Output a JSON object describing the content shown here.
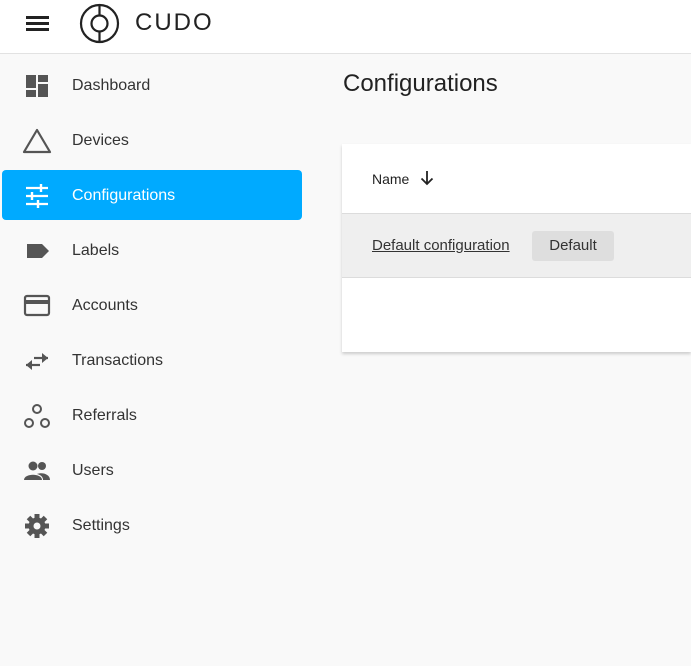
{
  "header": {
    "brand": "CUDO",
    "menu_icon": "hamburger-icon",
    "logo_icon": "cudo-logo-icon"
  },
  "sidebar": {
    "items": [
      {
        "label": "Dashboard",
        "icon": "dashboard-icon",
        "active": false
      },
      {
        "label": "Devices",
        "icon": "triangle-icon",
        "active": false
      },
      {
        "label": "Configurations",
        "icon": "tune-sliders-icon",
        "active": true
      },
      {
        "label": "Labels",
        "icon": "label-tag-icon",
        "active": false
      },
      {
        "label": "Accounts",
        "icon": "credit-card-icon",
        "active": false
      },
      {
        "label": "Transactions",
        "icon": "swap-arrows-icon",
        "active": false
      },
      {
        "label": "Referrals",
        "icon": "referrals-nodes-icon",
        "active": false
      },
      {
        "label": "Users",
        "icon": "people-icon",
        "active": false
      },
      {
        "label": "Settings",
        "icon": "gear-icon",
        "active": false
      }
    ],
    "active_color": "#00aaff"
  },
  "main": {
    "title": "Configurations",
    "table": {
      "columns": [
        {
          "label": "Name",
          "sort": "descending",
          "sort_icon": "arrow-down-icon"
        }
      ],
      "rows": [
        {
          "name": "Default configuration",
          "badge": "Default"
        }
      ]
    }
  }
}
